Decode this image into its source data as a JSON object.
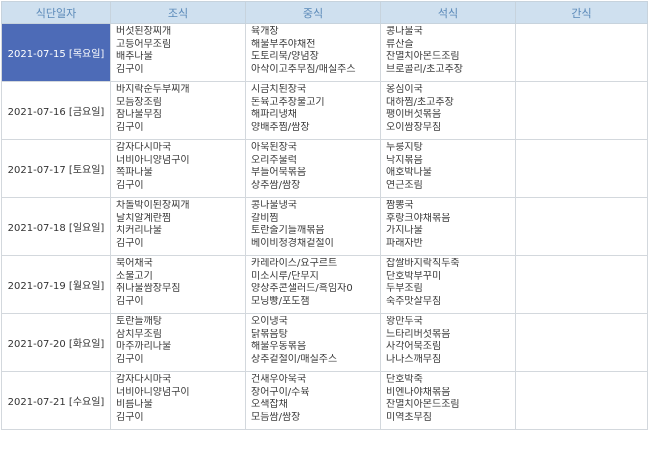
{
  "headers": [
    "식단일자",
    "조식",
    "중식",
    "석식",
    "간식"
  ],
  "rows": [
    {
      "date": "2021-07-15 [목요일]",
      "breakfast": [
        "버섯된장찌개",
        "고등어무조림",
        "배추나물",
        "김구이"
      ],
      "lunch": [
        "육개장",
        "해물부추야채전",
        "도토리묵/양념장",
        "아삭이고추무침/매실주스"
      ],
      "dinner": [
        "콩나물국",
        "류산슬",
        "잔멸치아몬드조림",
        "브로콜리/초고추장"
      ],
      "snack": []
    },
    {
      "date": "2021-07-16 [금요일]",
      "breakfast": [
        "바지락순두부찌개",
        "모듬장조림",
        "참나물무침",
        "김구이"
      ],
      "lunch": [
        "시금치된장국",
        "돈육고추장불고기",
        "해파리냉채",
        "양배추찜/쌈장"
      ],
      "dinner": [
        "옹심이국",
        "대하찜/초고추장",
        "팽이버섯볶음",
        "오이쌈장무침"
      ],
      "snack": []
    },
    {
      "date": "2021-07-17 [토요일]",
      "breakfast": [
        "감자다시마국",
        "너비아니양념구이",
        "쪽파나물",
        "김구이"
      ],
      "lunch": [
        "아욱된장국",
        "오리주물럭",
        "부들어묵볶음",
        "상추쌈/쌈장"
      ],
      "dinner": [
        "누룽지탕",
        "낙지볶음",
        "애호박나물",
        "연근조림"
      ],
      "snack": []
    },
    {
      "date": "2021-07-18 [일요일]",
      "breakfast": [
        "차돌박이된장찌개",
        "날치알계란찜",
        "치커리나물",
        "김구이"
      ],
      "lunch": [
        "콩나물냉국",
        "갈비찜",
        "토란줄기들깨볶음",
        "베이비청경채겉절이"
      ],
      "dinner": [
        "짬뽕국",
        "후랑크야채볶음",
        "가지나물",
        "파래자반"
      ],
      "snack": []
    },
    {
      "date": "2021-07-19 [월요일]",
      "breakfast": [
        "북어채국",
        "소불고기",
        "취나물쌈장무침",
        "김구이"
      ],
      "lunch": [
        "카레라이스/요구르트",
        "미소시루/단무지",
        "양상추콘샐러드/흑임자0",
        "모닝빵/포도잼"
      ],
      "dinner": [
        "찹쌀바지락칙두죽",
        "단호박부꾸미",
        "두부조림",
        "숙주맛살무침"
      ],
      "snack": []
    },
    {
      "date": "2021-07-20 [화요일]",
      "breakfast": [
        "토란들깨탕",
        "삼치무조림",
        "마주까리나물",
        "김구이"
      ],
      "lunch": [
        "오이냉국",
        "닭볶음탕",
        "해물우동볶음",
        "상추겉절이/매실주스"
      ],
      "dinner": [
        "왕만두국",
        "느타리버섯볶음",
        "사각어묵조림",
        "나나스깨무침"
      ],
      "snack": []
    },
    {
      "date": "2021-07-21 [수요일]",
      "breakfast": [
        "감자다시마국",
        "너비아니양념구이",
        "비름나물",
        "김구이"
      ],
      "lunch": [
        "건새우아욱국",
        "장어구이/수육",
        "오색잡채",
        "모듬쌈/쌈장"
      ],
      "dinner": [
        "단호박죽",
        "비엔나야채볶음",
        "잔멸치아몬드조림",
        "미역초무침"
      ],
      "snack": []
    }
  ],
  "selected_row": 0,
  "colors": {
    "header_bg": "#cfe0ef",
    "header_text": "#5a89b8",
    "selected_bg": "#4d6bb7",
    "selected_text": "#ffffff",
    "grid_line": "#d3d8dd"
  }
}
